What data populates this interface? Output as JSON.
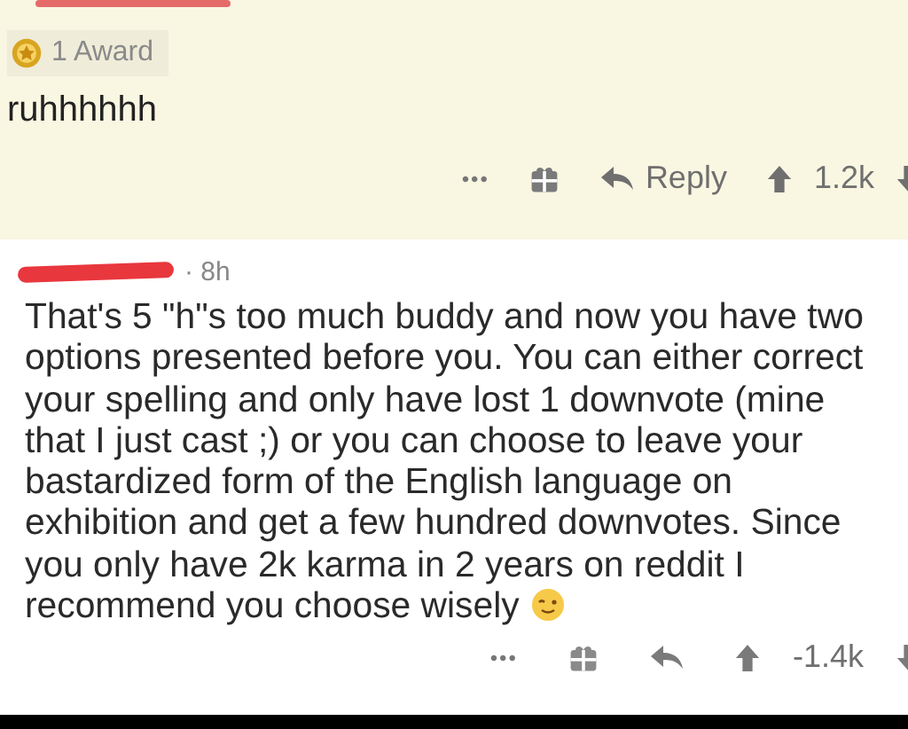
{
  "parent_comment": {
    "award": "1 Award",
    "body": "ruhhhhhh",
    "actions": {
      "more": "•••",
      "reply": "Reply",
      "score": "1.2k"
    }
  },
  "reply_comment": {
    "time": "· 8h",
    "lines": [
      "That's 5 \"h\"s too much buddy and now you have two",
      "options presented before you. You can either correct",
      "your spelling and only have lost 1 downvote (mine",
      "that I just cast ;) or you can choose to leave your",
      "bastardized form of the English language on",
      "exhibition and get a few hundred downvotes. Since",
      "you only have 2k karma in 2 years on reddit I",
      "recommend you choose wisely"
    ],
    "actions": {
      "more": "•••",
      "score": "-1.4k"
    }
  }
}
